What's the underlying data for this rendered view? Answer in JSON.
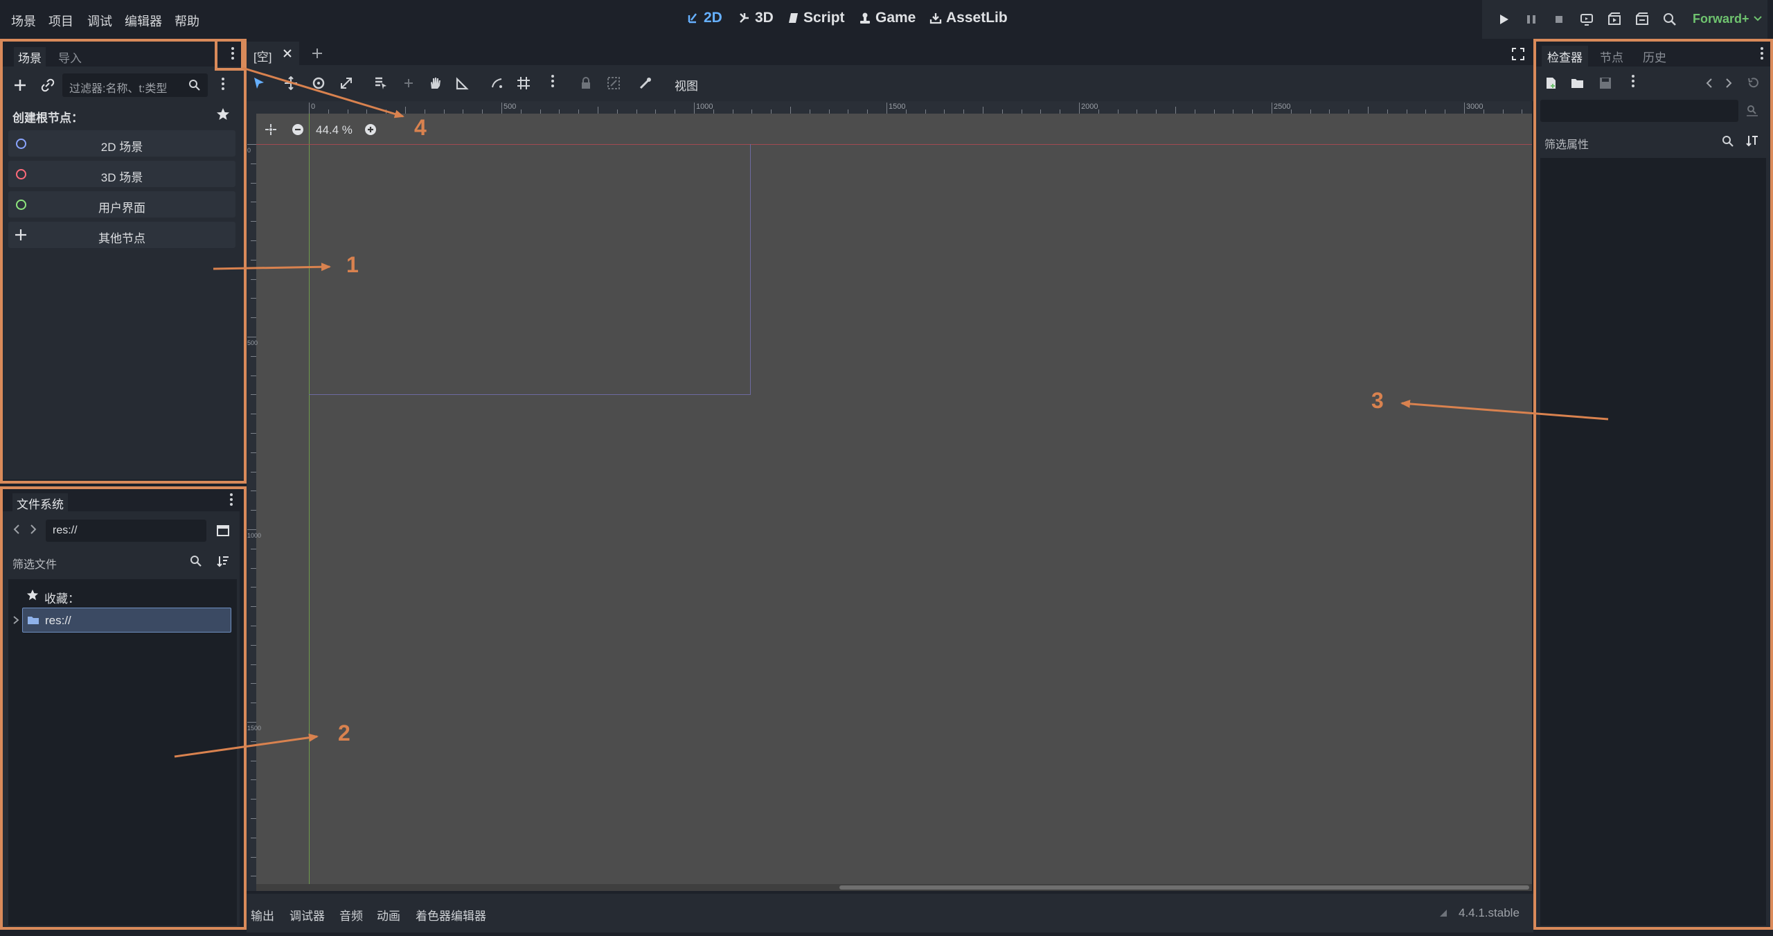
{
  "menu": [
    "场景",
    "项目",
    "调试",
    "编辑器",
    "帮助"
  ],
  "workspaces": [
    {
      "label": "2D",
      "active": true,
      "icon": "2d-workspace-icon"
    },
    {
      "label": "3D",
      "active": false,
      "icon": "3d-workspace-icon"
    },
    {
      "label": "Script",
      "active": false,
      "icon": "script-icon"
    },
    {
      "label": "Game",
      "active": false,
      "icon": "game-icon"
    },
    {
      "label": "AssetLib",
      "active": false,
      "icon": "assetlib-icon"
    }
  ],
  "renderer": "Forward+",
  "scene_dock": {
    "tabs": [
      "场景",
      "导入"
    ],
    "filter_placeholder": "过滤器:名称、t:类型",
    "create_root_label": "创建根节点：",
    "root_buttons": [
      {
        "label": "2D 场景",
        "color": "#8aa5ff"
      },
      {
        "label": "3D 场景",
        "color": "#ff6b7a"
      },
      {
        "label": "用户界面",
        "color": "#8ee67e"
      },
      {
        "label": "其他节点",
        "color": ""
      }
    ]
  },
  "filesystem_dock": {
    "title": "文件系统",
    "path": "res://",
    "filter_placeholder": "筛选文件",
    "favorites_label": "收藏：",
    "root_item": "res://"
  },
  "viewport": {
    "tab_label": "[空]",
    "view_menu": "视图",
    "zoom": "44.4 %",
    "ruler_labels": [
      "0",
      "500",
      "1000",
      "1500",
      "2000",
      "2500",
      "3000"
    ],
    "v_ruler_labels": [
      "0",
      "500",
      "1000",
      "1500"
    ]
  },
  "bottom_panel": {
    "tabs": [
      "输出",
      "调试器",
      "音频",
      "动画",
      "着色器编辑器"
    ],
    "version": "4.4.1.stable"
  },
  "inspector_dock": {
    "tabs": [
      "检查器",
      "节点",
      "历史"
    ],
    "filter_placeholder": "筛选属性"
  },
  "callouts": [
    "1",
    "2",
    "3",
    "4"
  ],
  "colors": {
    "accent": "#66b0ff",
    "highlight": "#d98a5a",
    "renderer": "#6fc36f"
  }
}
